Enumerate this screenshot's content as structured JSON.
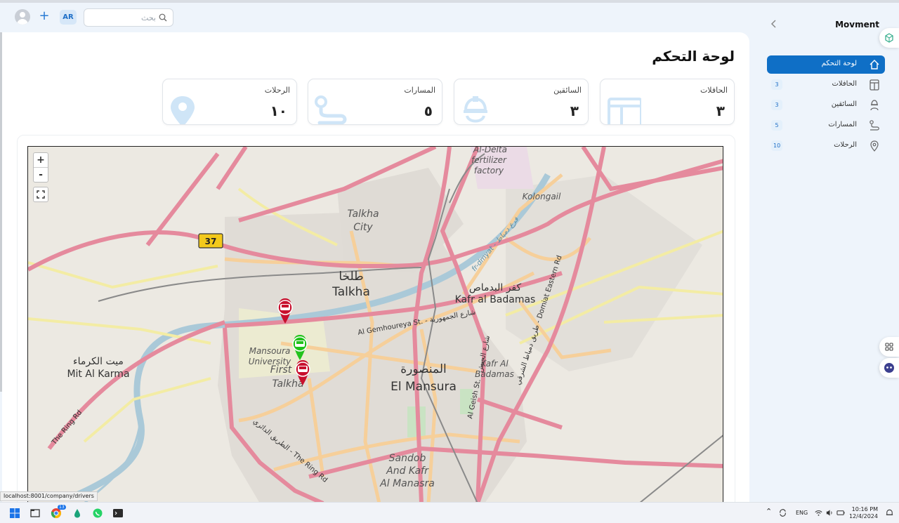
{
  "app": {
    "brand": "Movment",
    "page_title": "لوحة التحكم"
  },
  "topbar": {
    "lang": "AR",
    "search_placeholder": "بحث"
  },
  "stats": [
    {
      "label": "الحافلات",
      "value": "٣",
      "icon": "bus-icon"
    },
    {
      "label": "السائقين",
      "value": "٣",
      "icon": "driver-icon"
    },
    {
      "label": "المسارات",
      "value": "٥",
      "icon": "route-icon"
    },
    {
      "label": "الرحلات",
      "value": "١٠",
      "icon": "location-pin-icon"
    }
  ],
  "sidebar": {
    "items": [
      {
        "label": "لوحة التحكم",
        "icon": "home-icon",
        "count": "",
        "active": true
      },
      {
        "label": "الحافلات",
        "icon": "bus-icon",
        "count": "3"
      },
      {
        "label": "السائقين",
        "icon": "driver-icon",
        "count": "3"
      },
      {
        "label": "المسارات",
        "icon": "route-icon",
        "count": "5"
      },
      {
        "label": "الرحلات",
        "icon": "location-pin-icon",
        "count": "10"
      }
    ]
  },
  "map": {
    "zoom_in": "+",
    "zoom_out": "-",
    "labels": {
      "highway": "37",
      "fertilizer1": "Al-Delta",
      "fertilizer2": "fertilizer",
      "fertilizer3": "factory",
      "kolongail": "Kolongail",
      "talkha_city1": "Talkha",
      "talkha_city2": "City",
      "talkha_ar": "طلخا",
      "talkha": "Talkha",
      "kafr_ar": "كفر البدماص",
      "kafr": "Kafr al Badamas",
      "kafr2a": "Kafr Al",
      "kafr2b": "Badamas",
      "gemhoureya": "Al Gemhoureya St. - شارع الجمهورية",
      "mansoura_uni1": "Mansoura",
      "mansoura_uni2": "University",
      "first_talkha1": "First",
      "first_talkha2": "Talkha",
      "mansoura_ar": "المنصورة",
      "mansoura": "El Mansura",
      "geish": "Al Geish St. - شارع الجيش",
      "mit_ar": "ميت الكرماء",
      "mit": "Mit Al Karma",
      "ring_left": "The Ring Rd",
      "ring_bottom": "الطريق الدائري - The Ring Rd",
      "sandob1": "Sandob",
      "sandob2": "And Kafr",
      "sandob3": "Al Manasra",
      "eastern": "طريق دمياط الشرقي - Domiat Eastern Rd",
      "fr_dmyat": "fr-dmyat - فرع دمياط"
    },
    "markers": [
      {
        "color": "#c8102e",
        "state": "stopped"
      },
      {
        "color": "#22c21c",
        "state": "moving"
      },
      {
        "color": "#c8102e",
        "state": "stopped"
      }
    ]
  },
  "status_url": "localhost:8001/company/drivers",
  "taskbar": {
    "lang": "ENG",
    "time": "10:16 PM",
    "date": "12/4/2024",
    "chrome_badge": "13"
  }
}
